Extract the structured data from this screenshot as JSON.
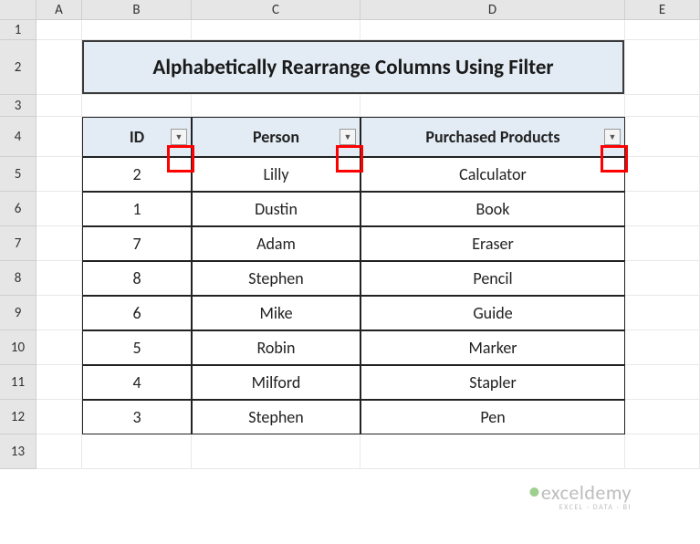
{
  "columns": [
    "A",
    "B",
    "C",
    "D",
    "E"
  ],
  "rows": [
    "1",
    "2",
    "3",
    "4",
    "5",
    "6",
    "7",
    "8",
    "9",
    "10",
    "11",
    "12",
    "13"
  ],
  "title": "Alphabetically Rearrange Columns Using Filter",
  "table": {
    "headers": [
      "ID",
      "Person",
      "Purchased Products"
    ],
    "data": [
      [
        "2",
        "Lilly",
        "Calculator"
      ],
      [
        "1",
        "Dustin",
        "Book"
      ],
      [
        "7",
        "Adam",
        "Eraser"
      ],
      [
        "8",
        "Stephen",
        "Pencil"
      ],
      [
        "6",
        "Mike",
        "Guide"
      ],
      [
        "5",
        "Robin",
        "Marker"
      ],
      [
        "4",
        "Milford",
        "Stapler"
      ],
      [
        "3",
        "Stephen",
        "Pen"
      ]
    ]
  },
  "watermark": {
    "top": "exceldemy",
    "bot": "EXCEL · DATA · BI"
  },
  "glyphs": {
    "filter_arrow": "▼"
  }
}
